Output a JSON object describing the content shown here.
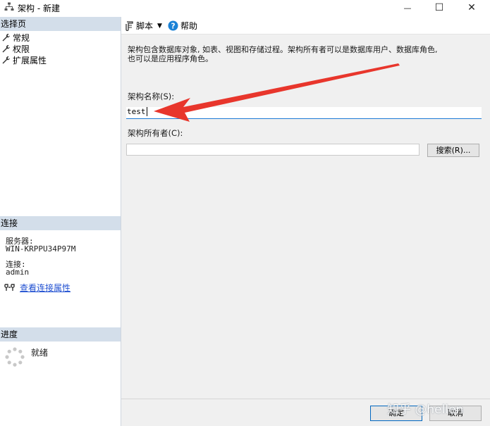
{
  "window": {
    "title": "架构 - 新建",
    "minimize_glyph": "—",
    "maximize_glyph": "☐",
    "close_glyph": "✕"
  },
  "sidebar": {
    "select_page_header": "选择页",
    "pages": [
      {
        "label": "常规",
        "icon": "wrench-icon"
      },
      {
        "label": "权限",
        "icon": "wrench-icon"
      },
      {
        "label": "扩展属性",
        "icon": "wrench-icon"
      }
    ],
    "connection_header": "连接",
    "server_label": "服务器:",
    "server_value": "WIN-KRPPU34P97M",
    "connection_label": "连接:",
    "connection_value": "admin",
    "view_connection_link": "查看连接属性",
    "progress_header": "进度",
    "progress_status": "就绪"
  },
  "toolbar": {
    "script_label": "脚本",
    "help_label": "帮助"
  },
  "main": {
    "description_line1": "架构包含数据库对象, 如表、视图和存储过程。架构所有者可以是数据库用户、数据库角色,",
    "description_line2": "也可以是应用程序角色。",
    "schema_name_label": "架构名称(S):",
    "schema_name_value": "test",
    "schema_owner_label": "架构所有者(C):",
    "schema_owner_value": "",
    "search_button": "搜索(R)...",
    "ok_button": "确定",
    "cancel_button": "取消"
  },
  "overlay": {
    "watermark": "知乎 @hellen",
    "arrow_color": "#e8362c"
  }
}
